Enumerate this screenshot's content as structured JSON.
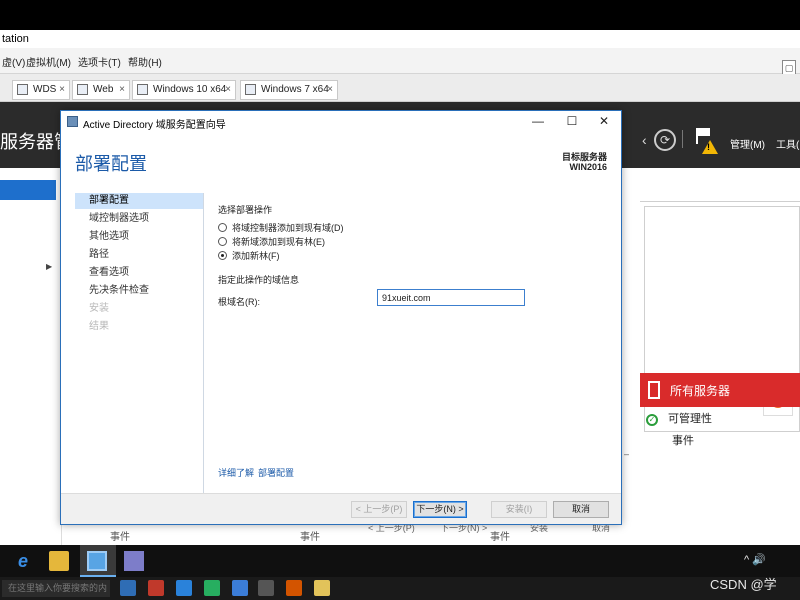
{
  "host": {
    "title_fragment": "tation",
    "menu": [
      "虚(V)",
      "虚拟机(M)",
      "选项卡(T)",
      "帮助(H)"
    ],
    "tabs": [
      "WDS",
      "Web",
      "Windows 10 x64",
      "Windows 7 x64"
    ]
  },
  "server_manager": {
    "title": "服务器管",
    "menu_manage": "管理(M)",
    "menu_tools": "工具(",
    "all_servers": "所有服务器",
    "manageability": "可管理性",
    "events": "事件",
    "bottom_events": [
      "事件",
      "事件",
      "事件"
    ]
  },
  "dialog": {
    "title": "Active Directory 域服务配置向导",
    "heading": "部署配置",
    "target_label": "目标服务器",
    "target_value": "WIN2016",
    "nav": [
      {
        "label": "部署配置",
        "state": "selected"
      },
      {
        "label": "域控制器选项",
        "state": "normal"
      },
      {
        "label": "其他选项",
        "state": "normal"
      },
      {
        "label": "路径",
        "state": "normal"
      },
      {
        "label": "查看选项",
        "state": "normal"
      },
      {
        "label": "先决条件检查",
        "state": "normal"
      },
      {
        "label": "安装",
        "state": "disabled"
      },
      {
        "label": "结果",
        "state": "disabled"
      }
    ],
    "select_op_title": "选择部署操作",
    "options": [
      {
        "label": "将域控制器添加到现有域(D)",
        "selected": false
      },
      {
        "label": "将新域添加到现有林(E)",
        "selected": false
      },
      {
        "label": "添加新林(F)",
        "selected": true
      }
    ],
    "domain_info_title": "指定此操作的域信息",
    "root_domain_label": "根域名(R):",
    "root_domain_value": "91xueit.com",
    "learn_more": "详细了解",
    "learn_more_link": "部署配置",
    "buttons": {
      "prev": "< 上一步(P)",
      "next": "下一步(N) >",
      "install": "安装(I)",
      "cancel": "取消"
    },
    "bleed_buttons": [
      "< 上一步(P)",
      "下一步(N) >",
      "安装",
      "取消"
    ]
  },
  "taskbar": {
    "search_placeholder": "在这里输入你要搜索的内容",
    "tray": "^ 🔊"
  },
  "watermark": "CSDN @学",
  "colors": {
    "accent": "#1b5aa8",
    "all_servers_red": "#d92b2b",
    "sm_header": "#2b2b2b"
  }
}
